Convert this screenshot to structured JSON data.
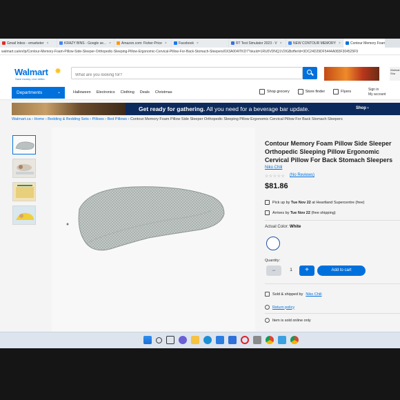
{
  "browser": {
    "tabs": [
      {
        "label": "Gmail Inbox - emarketer",
        "color": "#d93025",
        "active": false
      },
      {
        "label": "KRAZY BINS - Google se...",
        "color": "#4285f4",
        "active": false
      },
      {
        "label": "Amazon.com: Fisher-Price",
        "color": "#ff9900",
        "active": false
      },
      {
        "label": "Facebook",
        "color": "#1877f2",
        "active": false
      },
      {
        "label": "RT Test Simulator 2023 - V",
        "color": "#3b6fd8",
        "active": false
      },
      {
        "label": "NEW CONTOUR MEMORY",
        "color": "#4285f4",
        "active": false
      },
      {
        "label": "Contour Memory Foam",
        "color": "#0071dc",
        "active": true
      }
    ],
    "url": "walmart.ca/en/ip/Contour-Memory-Foam-Pillow-Side-Sleeper-Orthopedic-Sleeping-Pillow-Ergonomic-Cervical-Pillow-For-Back-Stomach-Sleepers/0X3A004ITKD7?skuId=1RU0VDNQ1V2IGBofferId=3DC24D29DF5444A083F304525F9"
  },
  "header": {
    "logo": "Walmart",
    "tagline": "Save money. Live better.",
    "search_placeholder": "What are you looking for?",
    "promo_side": "Walmart Sha"
  },
  "nav": {
    "departments": "Departments",
    "links": [
      "Halloween",
      "Electronics",
      "Clothing",
      "Deals",
      "Christmas"
    ],
    "grocery": "Shop grocery",
    "store": "Store finder",
    "flyers": "Flyers",
    "signin": "Sign in",
    "account": "My account"
  },
  "banner": {
    "bold": "Get ready for gathering.",
    "text": " All you need for a beverage bar update.",
    "shop": "Shop ›"
  },
  "breadcrumb": {
    "items": [
      "Walmart.ca",
      "Home",
      "Bedding & Bedding Sets",
      "Pillows",
      "Bed Pillows"
    ],
    "current": "Contour Memory Foam Pillow Side Sleeper Orthopedic Sleeping Pillow Ergonomic Cervical Pillow For Back Stomach Sleepers"
  },
  "product": {
    "title": "Contour Memory Foam Pillow Side Sleeper Orthopedic Sleeping Pillow Ergonomic Cervical Pillow For Back Stomach Sleepers",
    "brand": "Niko Chili",
    "stars": "☆☆☆☆☆",
    "reviews": "(No Reviews)",
    "price": "$81.86",
    "pickup_prefix": "Pick up by",
    "pickup_date": "Tue Nov 22",
    "pickup_suffix": "at Heartland Supercentre (free)",
    "arrives_prefix": "Arrives by",
    "arrives_date": "Tue Nov 22",
    "arrives_suffix": "(free shipping)",
    "color_label": "Actual Color:",
    "color_value": "White",
    "quantity_label": "Quantity:",
    "quantity": "1",
    "add_to_cart": "Add to cart",
    "sold_by_prefix": "Sold & shipped by",
    "sold_by": "Niko Chili",
    "return_policy": "Return policy",
    "online_only": "Item is sold online only"
  },
  "colors": {
    "brand_blue": "#0071dc",
    "spark_yellow": "#ffc220",
    "banner_navy": "#0d2a5c"
  }
}
